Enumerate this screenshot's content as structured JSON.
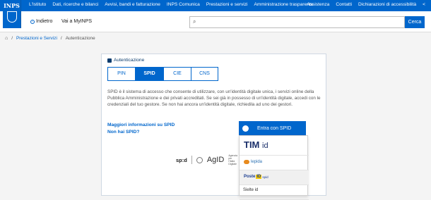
{
  "header": {
    "logo_text": "INPS",
    "nav": [
      "L'Istituto",
      "Dati, ricerche e bilanci",
      "Avvisi, bandi e fatturazione",
      "INPS Comunica",
      "Prestazioni e servizi",
      "Amministrazione trasparente"
    ],
    "util": [
      "Assistenza",
      "Contatti",
      "Dichiarazioni di accessibilità"
    ],
    "back_label": "Indietro",
    "myinps_label": "Vai a MyINPS",
    "search_button": "Cerca"
  },
  "breadcrumb": [
    "Prestazioni e Servizi",
    "Autenticazione"
  ],
  "auth": {
    "title": "Autenticazione",
    "tabs": [
      "PIN",
      "SPID",
      "CIE",
      "CNS"
    ],
    "active_tab": "SPID",
    "description": "SPID è il sistema di accesso che consente di utilizzare, con un'identità digitale unica, i servizi online della Pubblica Amministrazione e dei privati accreditati. Se sei già in possesso di un'identità digitale, accedi con le credenziali del tuo gestore. Se non hai ancora un'identità digitale, richiedila ad uno dei gestori.",
    "more_info_link": "Maggiori informazioni su SPID",
    "no_spid_link": "Non hai SPID?",
    "spid_button": "Entra con SPID",
    "footer_spid": "sp:d",
    "footer_agid": "AgID",
    "footer_agid_sub": "Agenzia per l'Italia Digitale"
  },
  "providers": {
    "tim": "TIM",
    "tim_id": "id",
    "lepida": "lepida",
    "poste": "Poste",
    "poste_id": "ID",
    "poste_spid": "spid",
    "sielte": "Sielte id"
  }
}
